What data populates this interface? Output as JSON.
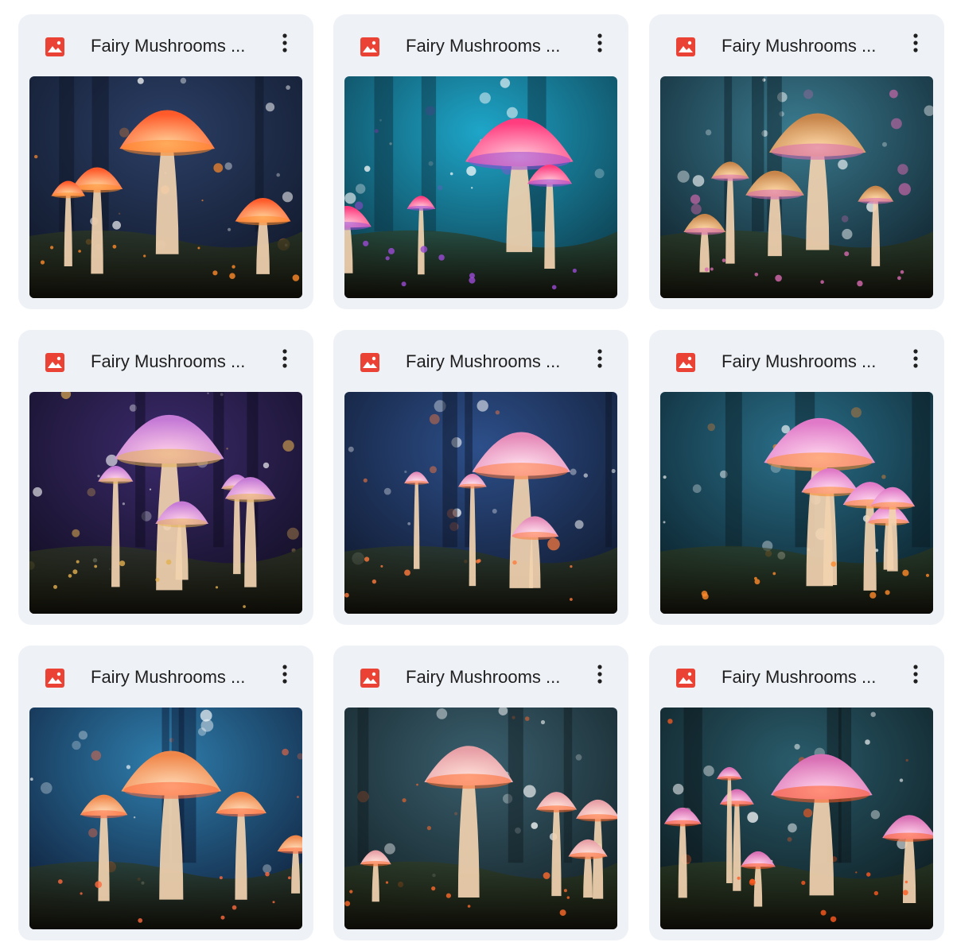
{
  "files": [
    {
      "name": "Fairy Mushrooms ...",
      "icon": "image-file-icon",
      "menu_icon": "more-vert-icon",
      "thumbnail": {
        "palette": [
          "#2b3f66",
          "#0e1424",
          "#ff5a2a",
          "#ffd29a",
          "#ff8a2a"
        ],
        "caps": 4
      }
    },
    {
      "name": "Fairy Mushrooms ...",
      "icon": "image-file-icon",
      "menu_icon": "more-vert-icon",
      "thumbnail": {
        "palette": [
          "#1ea6c9",
          "#0b2f3d",
          "#ff3d7f",
          "#ffc7d8",
          "#9b4bd6"
        ],
        "caps": 4
      }
    },
    {
      "name": "Fairy Mushrooms ...",
      "icon": "image-file-icon",
      "menu_icon": "more-vert-icon",
      "thumbnail": {
        "palette": [
          "#3a7b8f",
          "#0c1a24",
          "#c7854a",
          "#ffd9a8",
          "#d86ab0"
        ],
        "caps": 5
      }
    },
    {
      "name": "Fairy Mushrooms ...",
      "icon": "image-file-icon",
      "menu_icon": "more-vert-icon",
      "thumbnail": {
        "palette": [
          "#3b2a6b",
          "#0e0c1c",
          "#c57ad6",
          "#ffd0e8",
          "#e3b050"
        ],
        "caps": 5
      }
    },
    {
      "name": "Fairy Mushrooms ...",
      "icon": "image-file-icon",
      "menu_icon": "more-vert-icon",
      "thumbnail": {
        "palette": [
          "#2d4f8a",
          "#0d1426",
          "#e58ab8",
          "#ffe2ef",
          "#ff7a3d"
        ],
        "caps": 4
      }
    },
    {
      "name": "Fairy Mushrooms ...",
      "icon": "image-file-icon",
      "menu_icon": "more-vert-icon",
      "thumbnail": {
        "palette": [
          "#2a6f8a",
          "#081a22",
          "#e07ac8",
          "#ffd7ee",
          "#ff8a2a"
        ],
        "caps": 5
      }
    },
    {
      "name": "Fairy Mushrooms ...",
      "icon": "image-file-icon",
      "menu_icon": "more-vert-icon",
      "thumbnail": {
        "palette": [
          "#2f7fae",
          "#0c1630",
          "#f0874a",
          "#ffd9b5",
          "#ff6a3d"
        ],
        "caps": 4
      }
    },
    {
      "name": "Fairy Mushrooms ...",
      "icon": "image-file-icon",
      "menu_icon": "more-vert-icon",
      "thumbnail": {
        "palette": [
          "#3a5f6e",
          "#0f1b1f",
          "#e79fa6",
          "#ffe0d9",
          "#ff6a2a"
        ],
        "caps": 5
      }
    },
    {
      "name": "Fairy Mushrooms ...",
      "icon": "image-file-icon",
      "menu_icon": "more-vert-icon",
      "thumbnail": {
        "palette": [
          "#2a5c6b",
          "#0a1418",
          "#d96fb4",
          "#ffd2ea",
          "#ff5a1f"
        ],
        "caps": 6
      }
    }
  ]
}
